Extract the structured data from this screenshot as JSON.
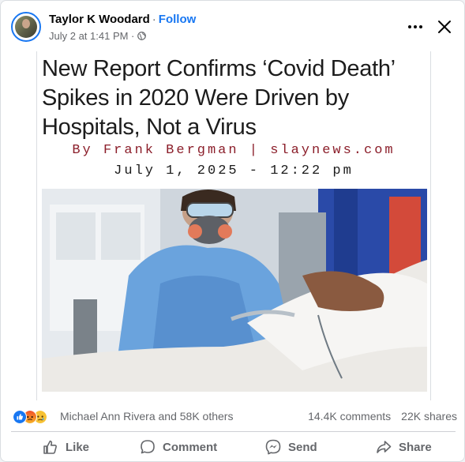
{
  "post": {
    "author": "Taylor K Woodard",
    "separator": "·",
    "follow_label": "Follow",
    "timestamp": "July 2 at 1:41 PM ·"
  },
  "article": {
    "headline": "New Report Confirms ‘Covid Death’ Spikes in 2020 Were Driven by Hospitals, Not a Virus",
    "byline": "By Frank Bergman | slaynews.com",
    "dateline": "July 1, 2025 - 12:22 pm"
  },
  "reactions": {
    "names": "Michael Ann Rivera and 58K others",
    "comments": "14.4K comments",
    "shares": "22K shares",
    "icons": [
      "like-icon",
      "angry-icon",
      "sad-icon"
    ]
  },
  "actions": {
    "like": "Like",
    "comment": "Comment",
    "send": "Send",
    "share": "Share"
  },
  "colors": {
    "accent": "#1877f2",
    "byline": "#8b1e2a",
    "secondary_text": "#65676b"
  }
}
